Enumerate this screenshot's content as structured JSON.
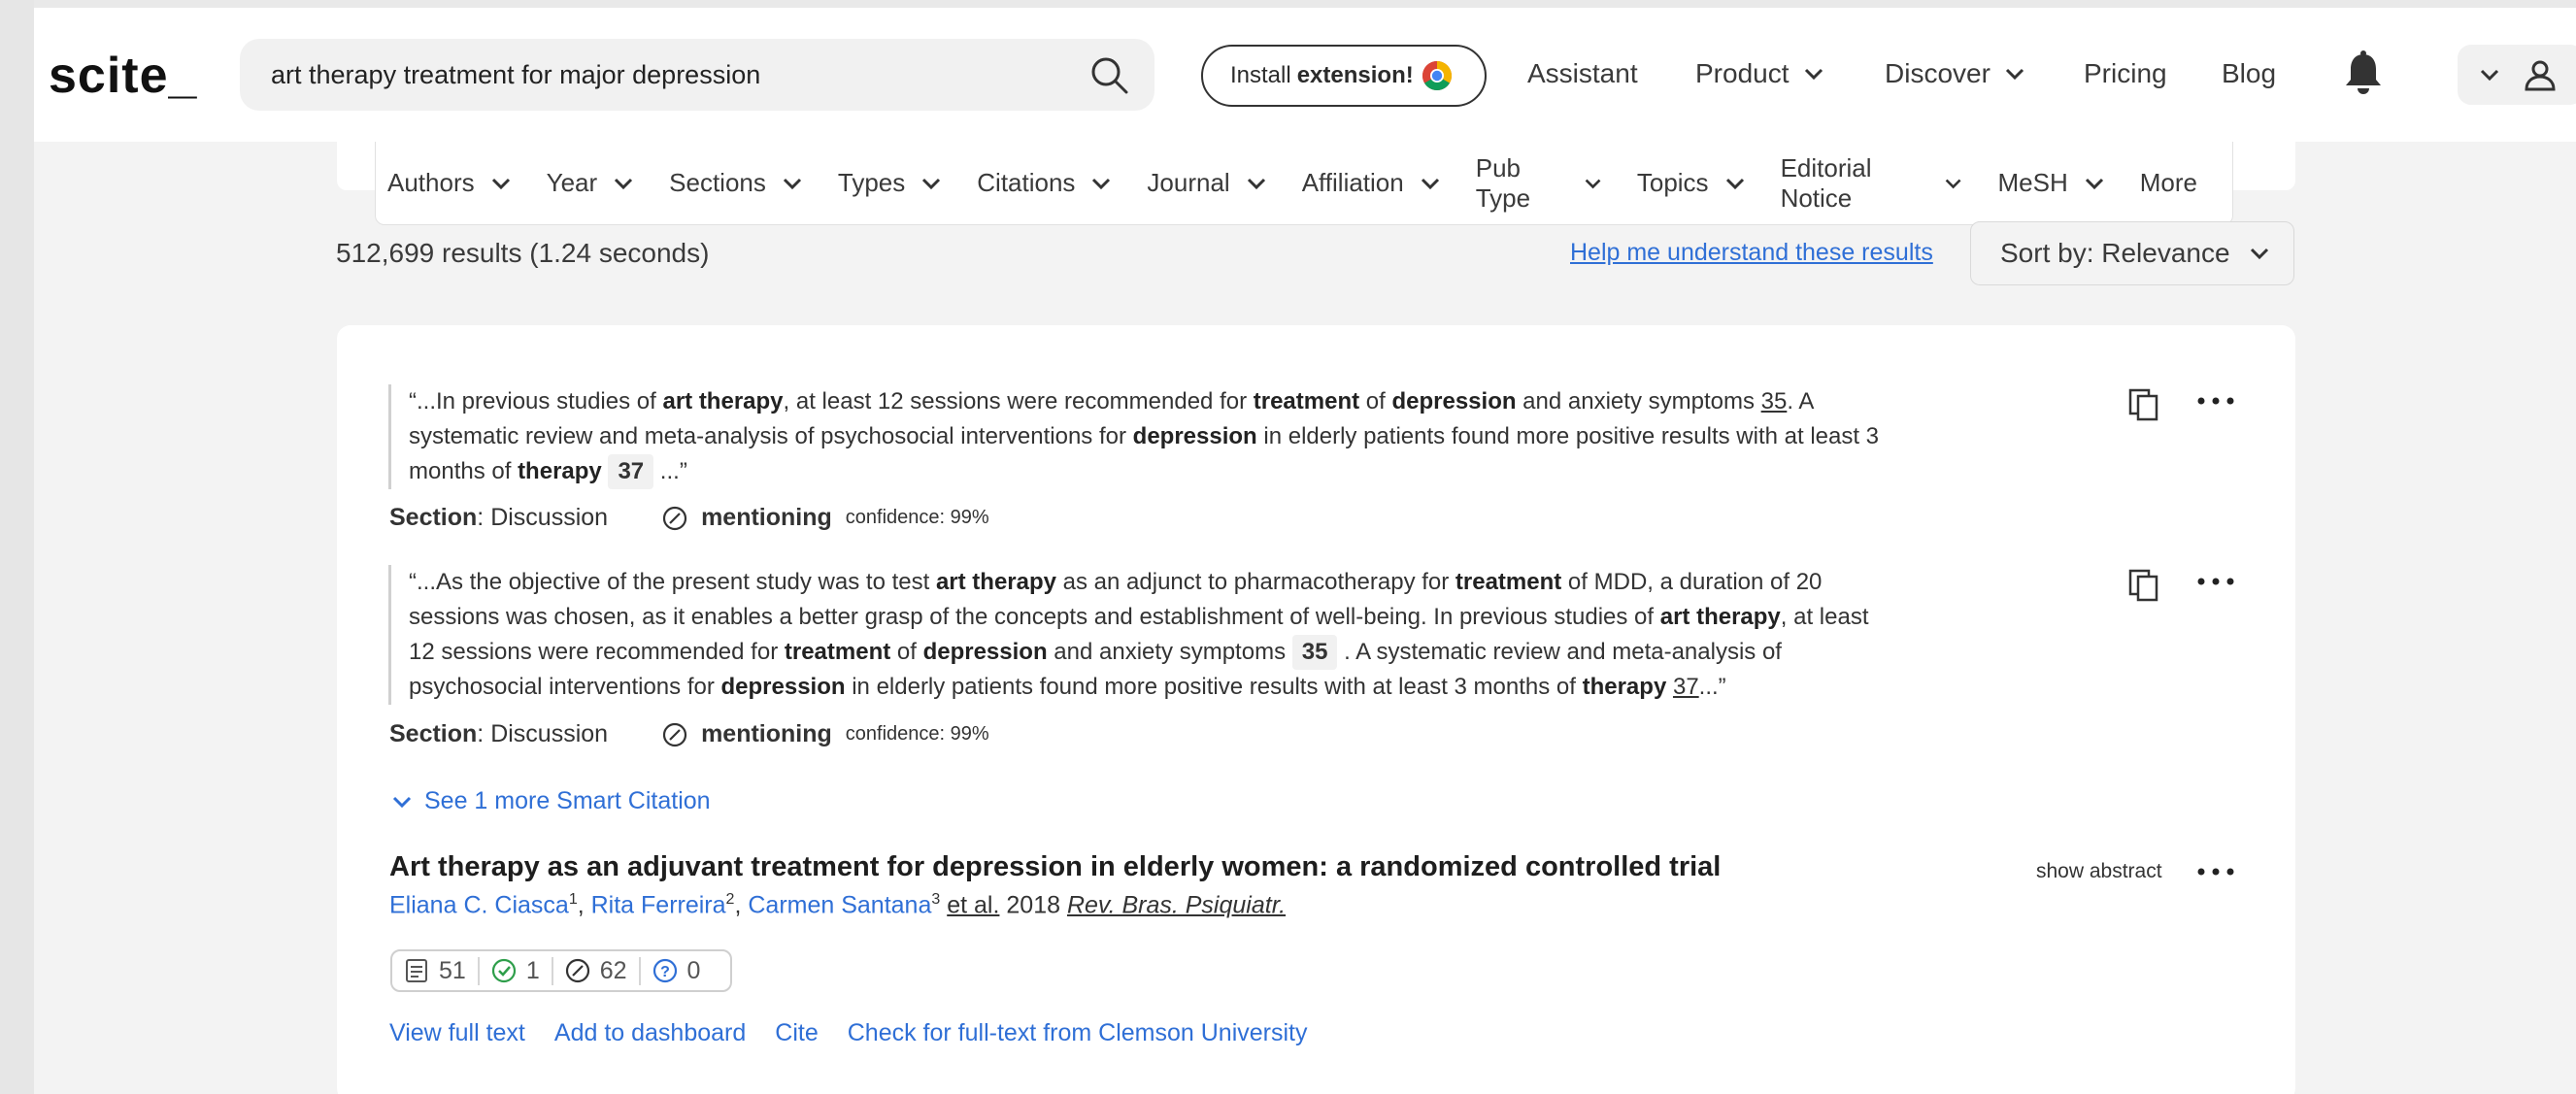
{
  "header": {
    "logo": "scite_",
    "search_value": "art therapy treatment for major depression",
    "install_prefix": "Install",
    "install_bold": "extension!",
    "nav": [
      "Assistant",
      "Product",
      "Discover",
      "Pricing",
      "Blog"
    ]
  },
  "filters": [
    "Authors",
    "Year",
    "Sections",
    "Types",
    "Citations",
    "Journal",
    "Affiliation",
    "Pub Type",
    "Topics",
    "Editorial Notice",
    "MeSH",
    "More"
  ],
  "results": {
    "count": "512,699 results (1.24 seconds)",
    "help_link": "Help me understand these results",
    "sort": "Sort by: Relevance"
  },
  "snippets": [
    {
      "section_label": "Section",
      "section_value": ": Discussion",
      "type": "mentioning",
      "confidence": "confidence: 99%"
    },
    {
      "section_label": "Section",
      "section_value": ": Discussion",
      "type": "mentioning",
      "confidence": "confidence: 99%"
    }
  ],
  "see_more": "See 1 more Smart Citation",
  "paper": {
    "title": "Art therapy as an adjuvant treatment for depression in elderly women: a randomized controlled trial",
    "show_abstract": "show abstract",
    "authors": [
      {
        "name": "Eliana C. Ciasca",
        "sup": "1"
      },
      {
        "name": "Rita Ferreira",
        "sup": "2"
      },
      {
        "name": "Carmen Santana",
        "sup": "3"
      }
    ],
    "etal": "et al.",
    "year": "2018",
    "journal": "Rev. Bras. Psiquiatr.",
    "stats": {
      "publications": "51",
      "supporting": "1",
      "mentioning": "62",
      "contrasting": "0"
    },
    "actions": [
      "View full text",
      "Add to dashboard",
      "Cite",
      "Check for full-text from Clemson University"
    ]
  },
  "colors": {
    "link": "#2f6fd6",
    "accent_green": "#2e9e4a",
    "accent_blue": "#2f6fd6"
  }
}
